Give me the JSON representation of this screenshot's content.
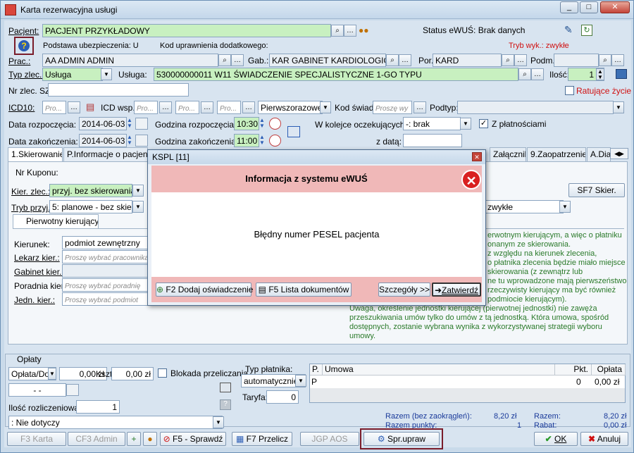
{
  "window": {
    "title": "Karta rezerwacyjna usługi",
    "min": "_",
    "max": "□",
    "close": "✕"
  },
  "patient": {
    "label": "Pacjent:",
    "value": "PACJENT PRZYKŁADOWY",
    "ewus_status": "Status eWUŚ: Brak danych",
    "insurance_basis": "Podstawa ubezpieczenia: U",
    "additional_rights": "Kod uprawnienia dodatkowego:",
    "mode": "Tryb wyk.: zwykłe"
  },
  "staff": {
    "label": "Prac.:",
    "value": "AA ADMIN ADMIN",
    "gab_label": "Gab.:",
    "gab_value": "KAR GABINET KARDIOLOGICZN",
    "por_label": "Por.",
    "por_value": "KARD",
    "podm_label": "Podm."
  },
  "order": {
    "type_label": "Typ zlec.:",
    "type_value": "Usługa",
    "service_label": "Usługa:",
    "service_value": "530000000011 W11 ŚWIADCZENIE SPECJALISTYCZNE 1-GO TYPU",
    "qty_label": "Ilość:",
    "qty_value": "1",
    "nr_label": "Nr zlec. SZ:",
    "life_saving": "Ratujące życie"
  },
  "icd": {
    "icd10_label": "ICD10:",
    "placeholder": "Pro...",
    "icd_wsp_label": "ICD wsp.:",
    "first_time": "Pierwszorazowe",
    "kod_swiad_label": "Kod świad.",
    "kod_swiad_placeholder": "Proszę wy",
    "podtyp_label": "Podtyp:"
  },
  "dates": {
    "start_date_label": "Data rozpoczęcia:",
    "start_date": "2014-06-03",
    "start_time_label": "Godzina rozpoczęcia:",
    "start_time": "10:30",
    "end_date_label": "Data zakończenia:",
    "end_date": "2014-06-03",
    "end_time_label": "Godzina zakończenia:",
    "end_time": "11:00",
    "queue_label": "W kolejce oczekujących:",
    "queue_value": "-: brak",
    "paid_label": "Z płatnościami",
    "with_date_label": "z datą:"
  },
  "tabs": [
    {
      "label": "1.Skierowanie"
    },
    {
      "label": "P.Informacje o pacjencie"
    },
    {
      "label": "Załączniki"
    },
    {
      "label": "9.Zaopatrzenie"
    },
    {
      "label": "A.Dia"
    }
  ],
  "referral": {
    "coupon_label": "Nr Kuponu:",
    "kier_label": "Kier. zlec.:",
    "kier_value": "przyj. bez skierowania",
    "tryb_label": "Tryb przyj.:",
    "tryb_value": "5: planowe - bez skier.",
    "mode_value": "zwykłe",
    "sf7_button": "SF7 Skier.",
    "subtab": "Pierwotny kierujący",
    "kierunek_label": "Kierunek:",
    "kierunek_value": "podmiot zewnętrzny",
    "lekarz_label": "Lekarz kier.:",
    "lekarz_placeholder": "Proszę wybrać pracownika",
    "gabinet_label": "Gabinet kier.:",
    "poradnia_label": "Poradnia kier.:",
    "poradnia_placeholder": "Proszę wybrać poradnię",
    "jedn_label": "Jedn. kier.:",
    "jedn_placeholder": "Proszę wybrać podmiot",
    "info_lines": [
      "erwotnym kierującym, a więc o płatniku",
      "onanym ze skierowania.",
      "z względu na kierunek zlecenia,",
      "o płatnika zlecenia będzie miało miejsce",
      "skierowania (z zewnątrz lub",
      "ne tu wprowadzone mają pierwszeństwo",
      "rzeczywisty kierujący ma być również",
      "podmiocie kierującym).",
      "Uwaga, określenie jednostki kierującej (pierwotnej jednostki) nie zawęża",
      "przeszukiwania umów tylko do umów z tą jednostką. Która umowa, spośród",
      "dostępnych, zostanie wybrana wynika z wykorzystywanej strategii wyboru umowy."
    ]
  },
  "dialog": {
    "title": "KSPL [11]",
    "header": "Informacja z systemu eWUŚ",
    "message": "Błędny numer PESEL pacjenta",
    "btn_add": "F2 Dodaj oświadczenie",
    "btn_list": "F5 Lista dokumentów",
    "btn_details": "Szczegóły >>",
    "btn_confirm": "Zatwierdź"
  },
  "payments": {
    "group_label": "Opłaty",
    "oplata_value": "Opłata/Do",
    "amount1": "0,00 zł",
    "ksz_label": "Kszt:",
    "ksz_value": "0,00 zł",
    "block_label": "Blokada przeliczania",
    "date_value": "-   -",
    "payer_type_label": "Typ płatnika:",
    "payer_type_value": "automatycznie",
    "taryfa_label": "Taryfa:",
    "taryfa_value": "0",
    "count_label": "Ilość rozliczeniowa:",
    "count_value": "1",
    "applicability": ": Nie dotyczy",
    "grid_headers": [
      "P.",
      "Umowa",
      "Pkt.",
      "Opłata"
    ],
    "grid_row": {
      "p": "P",
      "umowa": "",
      "pkt": "0",
      "oplata": "0,00 zł"
    },
    "razem_label": "Razem (bez zaokrągleń):",
    "razem_value": "8,20 zł",
    "razem_pkt_label": "Razem punkty:",
    "razem_pkt_value": "1",
    "razem2_label": "Razem:",
    "razem2_value": "8,20 zł",
    "rabat_label": "Rabat:",
    "rabat_value": "0,00 zł"
  },
  "bottom_bar": {
    "f3": "F3 Karta",
    "cf3": "CF3 Admin",
    "f5": "F5 - Sprawdź",
    "f7": "F7 Przelicz",
    "jgp": "JGP AOS",
    "spr": "Spr.upraw",
    "ok": "OK",
    "cancel": "Anuluj"
  },
  "colors": {
    "accent": "#7a1c2a",
    "green_field": "#c8f0c0",
    "dialog_head": "#f0b8b8",
    "info_text": "#2a7a2a"
  }
}
